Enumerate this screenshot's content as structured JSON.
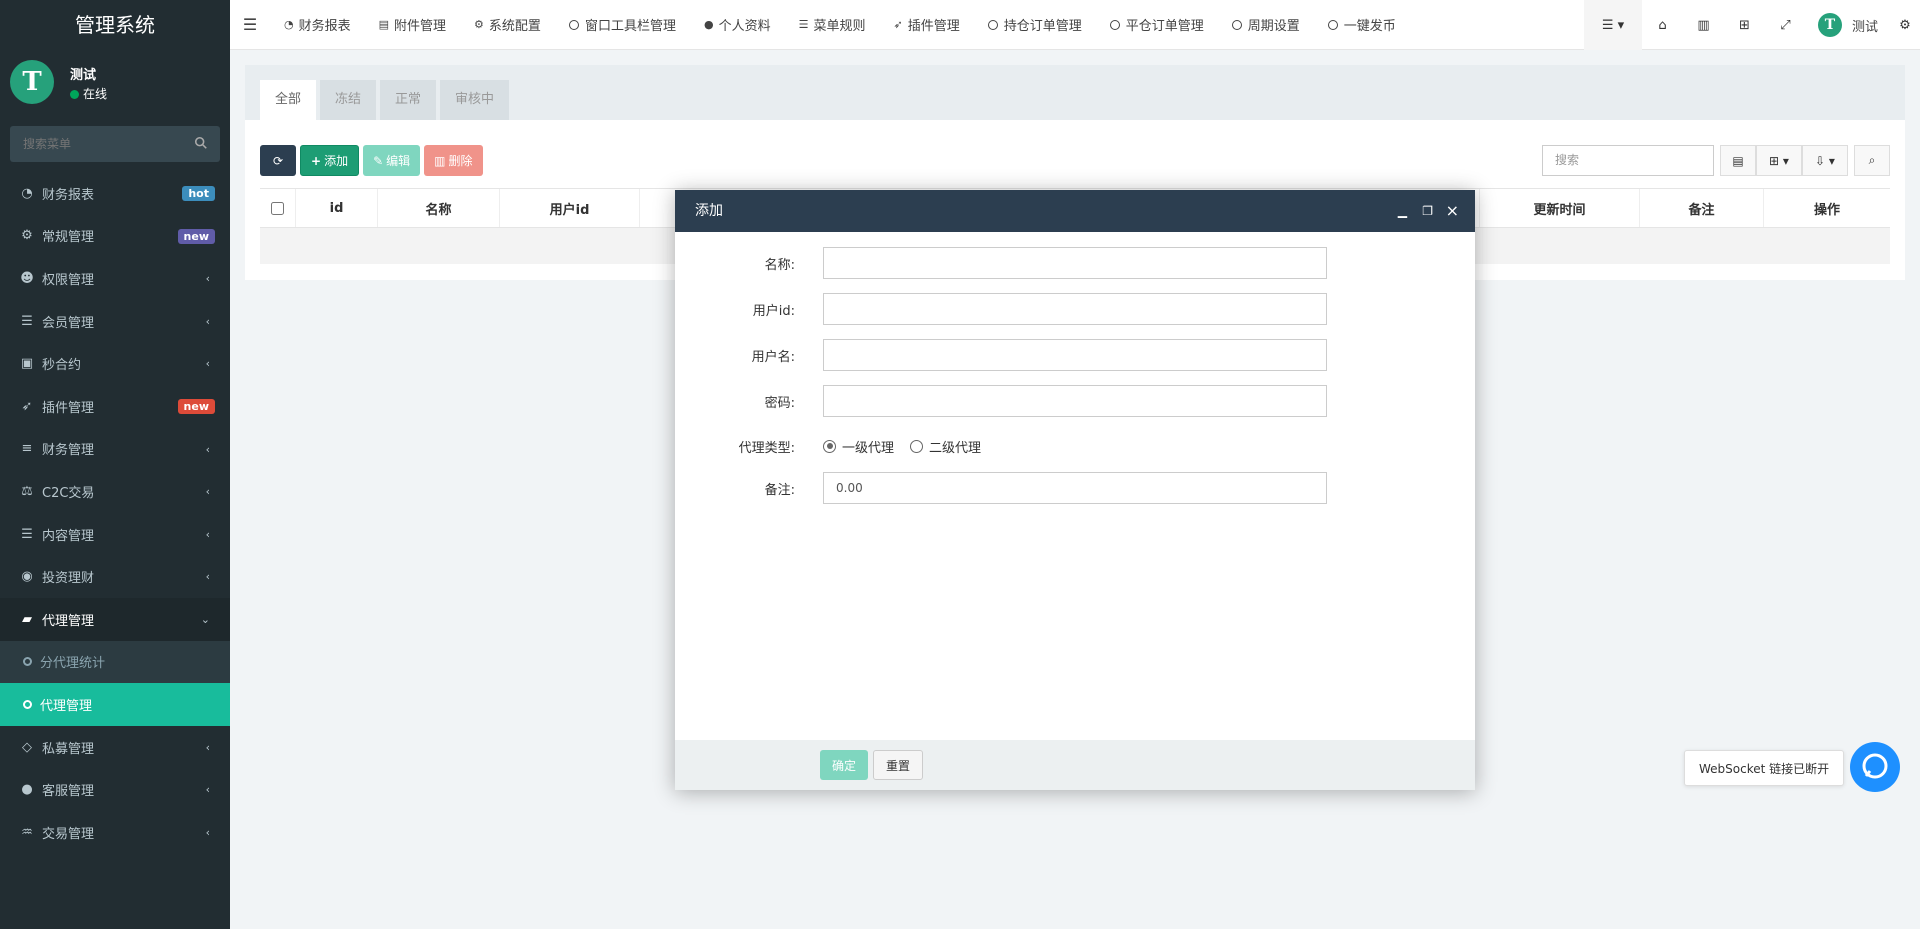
{
  "brand": "管理系统",
  "user": {
    "name": "测试",
    "status": "在线",
    "avatar_letter": "T"
  },
  "sidebar": {
    "search_placeholder": "搜索菜单",
    "items": [
      {
        "label": "财务报表",
        "icon": "dashboard-icon",
        "badge": "hot",
        "badge_color": "#3c8dbc"
      },
      {
        "label": "常规管理",
        "icon": "cogs-icon",
        "badge": "new",
        "badge_color": "#605ca8"
      },
      {
        "label": "权限管理",
        "icon": "group-icon"
      },
      {
        "label": "会员管理",
        "icon": "list-icon"
      },
      {
        "label": "秒合约",
        "icon": "calendar-icon"
      },
      {
        "label": "插件管理",
        "icon": "rocket-icon",
        "badge": "new",
        "badge_color": "#dd4b39"
      },
      {
        "label": "财务管理",
        "icon": "database-icon"
      },
      {
        "label": "C2C交易",
        "icon": "balance-scale-icon"
      },
      {
        "label": "内容管理",
        "icon": "align-left-icon"
      },
      {
        "label": "投资理财",
        "icon": "compass-icon"
      },
      {
        "label": "代理管理",
        "icon": "briefcase-icon"
      },
      {
        "label": "分代理统计",
        "sub": true
      },
      {
        "label": "代理管理",
        "sub": true
      },
      {
        "label": "私募管理",
        "icon": "diamond-icon"
      },
      {
        "label": "客服管理",
        "icon": "comment-icon"
      },
      {
        "label": "交易管理",
        "icon": "handshake-icon"
      }
    ]
  },
  "topnav": {
    "tabs": [
      {
        "label": "财务报表",
        "icon": "dashboard-icon"
      },
      {
        "label": "附件管理",
        "icon": "file-image-icon"
      },
      {
        "label": "系统配置",
        "icon": "cog-icon"
      },
      {
        "label": "窗口工具栏管理",
        "icon": "circle-icon"
      },
      {
        "label": "个人资料",
        "icon": "user-icon"
      },
      {
        "label": "菜单规则",
        "icon": "bars-icon"
      },
      {
        "label": "插件管理",
        "icon": "rocket-icon"
      },
      {
        "label": "持仓订单管理",
        "icon": "circle-icon"
      },
      {
        "label": "平仓订单管理",
        "icon": "circle-icon"
      },
      {
        "label": "周期设置",
        "icon": "circle-icon"
      },
      {
        "label": "一键发币",
        "icon": "circle-icon"
      }
    ],
    "user_name": "测试"
  },
  "panel": {
    "tabs": [
      "全部",
      "冻结",
      "正常",
      "审核中"
    ],
    "toolbar": {
      "add": "添加",
      "edit": "编辑",
      "delete": "删除"
    },
    "search_placeholder": "搜索",
    "columns": [
      "id",
      "名称",
      "用户id",
      "更新时间",
      "备注",
      "操作"
    ]
  },
  "modal": {
    "title": "添加",
    "fields": {
      "name": {
        "label": "名称:",
        "value": ""
      },
      "user_id": {
        "label": "用户id:",
        "value": ""
      },
      "username": {
        "label": "用户名:",
        "value": ""
      },
      "password": {
        "label": "密码:",
        "value": ""
      },
      "agent_type": {
        "label": "代理类型:",
        "options": [
          "一级代理",
          "二级代理"
        ],
        "selected": "一级代理"
      },
      "remark": {
        "label": "备注:",
        "value": "0.00"
      }
    },
    "ok": "确定",
    "reset": "重置"
  },
  "websocket": {
    "message": "WebSocket 链接已断开"
  },
  "colors": {
    "sidebar": "#222d32",
    "accent": "#18bc9c",
    "header": "#2c3e50"
  }
}
